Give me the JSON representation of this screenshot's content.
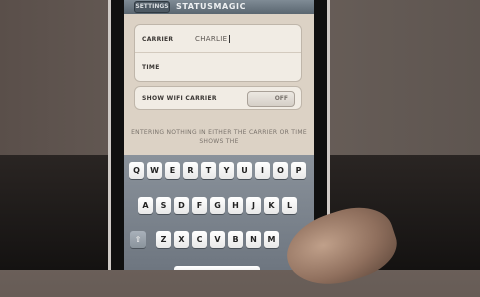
{
  "nav": {
    "back_label": "SETTINGS",
    "title": "STATUSMAGIC"
  },
  "fields": {
    "carrier_label": "CARRIER",
    "carrier_value": "CHARLIE",
    "time_label": "TIME",
    "time_value": ""
  },
  "wifi": {
    "label": "SHOW WIFI CARRIER",
    "toggle_state": "OFF"
  },
  "note": "ENTERING NOTHING IN EITHER THE CARRIER OR TIME SHOWS THE",
  "keyboard": {
    "row1": [
      "Q",
      "W",
      "E",
      "R",
      "T",
      "Y",
      "U",
      "I",
      "O",
      "P"
    ],
    "row2": [
      "A",
      "S",
      "D",
      "F",
      "G",
      "H",
      "J",
      "K",
      "L"
    ],
    "row3": [
      "Z",
      "X",
      "C",
      "V",
      "B",
      "N",
      "M"
    ],
    "shift_icon": "shift-arrow-icon"
  },
  "colors": {
    "navbar": "#6a7680",
    "table_bg": "#f1ece4",
    "screen_bg": "#dcd2c5",
    "keyboard_bg": "#7c858f"
  }
}
